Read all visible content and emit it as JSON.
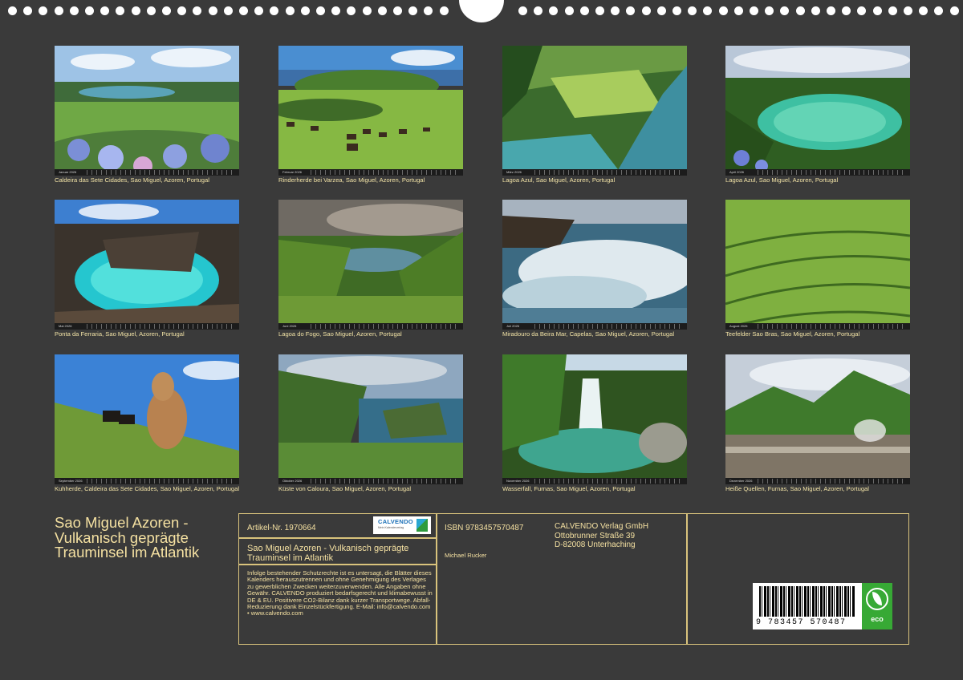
{
  "title": "Sao Miguel Azoren - Vulkanisch geprägte Trauminsel im Atlantik",
  "months": [
    {
      "cal": "Januar 2026",
      "caption": "Caldeira das Sete Cidades, Sao Miguel, Azoren, Portugal"
    },
    {
      "cal": "Februar 2026",
      "caption": "Rinderherde bei Varzea, Sao Miguel, Azoren, Portugal"
    },
    {
      "cal": "März 2026",
      "caption": "Lagoa Azul, Sao Miguel, Azoren, Portugal"
    },
    {
      "cal": "April 2026",
      "caption": "Lagoa Azul, Sao Miguel, Azoren, Portugal"
    },
    {
      "cal": "Mai 2026",
      "caption": "Ponta da Ferraria, Sao Miguel, Azoren, Portugal"
    },
    {
      "cal": "Juni 2026",
      "caption": "Lagoa do Fogo, Sao Miguel, Azoren, Portugal"
    },
    {
      "cal": "Juli 2026",
      "caption": "Miradouro da Beira Mar, Capelas, Sao Miguel, Azoren, Portugal"
    },
    {
      "cal": "August 2026",
      "caption": "Teefelder Sao Bras, Sao Miguel, Azoren, Portugal"
    },
    {
      "cal": "September 2026",
      "caption": "Kuhherde, Caldeira das Sete Cidades, Sao Miguel, Azoren, Portugal"
    },
    {
      "cal": "Oktober 2026",
      "caption": "Küste von Caloura, Sao Miguel, Azoren, Portugal"
    },
    {
      "cal": "November 2026",
      "caption": "Wasserfall, Furnas, Sao Miguel, Azoren, Portugal"
    },
    {
      "cal": "Dezember 2026",
      "caption": "Heiße Quellen, Furnas, Sao Miguel, Azoren, Portugal"
    }
  ],
  "info": {
    "article": "Artikel-Nr. 1970664",
    "logo_name": "CALVENDO",
    "logo_tagline": "Mein Kalenderverlag",
    "product_title": "Sao Miguel Azoren - Vulkanisch geprägte Trauminsel im Atlantik",
    "legal_text": "Infolge bestehender Schutzrechte ist es untersagt, die Blätter dieses Kalenders herauszutrennen und ohne Genehmigung des Verlages zu gewerblichen Zwecken weiterzuverwenden. Alle Angaben ohne Gewähr. CALVENDO produziert bedarfsgerecht und klimabewusst in DE & EU. Positivere CO2-Bilanz dank kurzer Transportwege. Abfall-Reduzierung dank Einzelstückfertigung. E-Mail: info@calvendo.com • www.calvendo.com",
    "isbn": "ISBN 9783457570487",
    "author": "Michael Rucker",
    "publisher": {
      "name": "CALVENDO Verlag GmbH",
      "street": "Ottobrunner Straße 39",
      "city": "D-82008 Unterhaching"
    },
    "barcode_digits": "9 783457 570487",
    "eco_label": "eco"
  }
}
